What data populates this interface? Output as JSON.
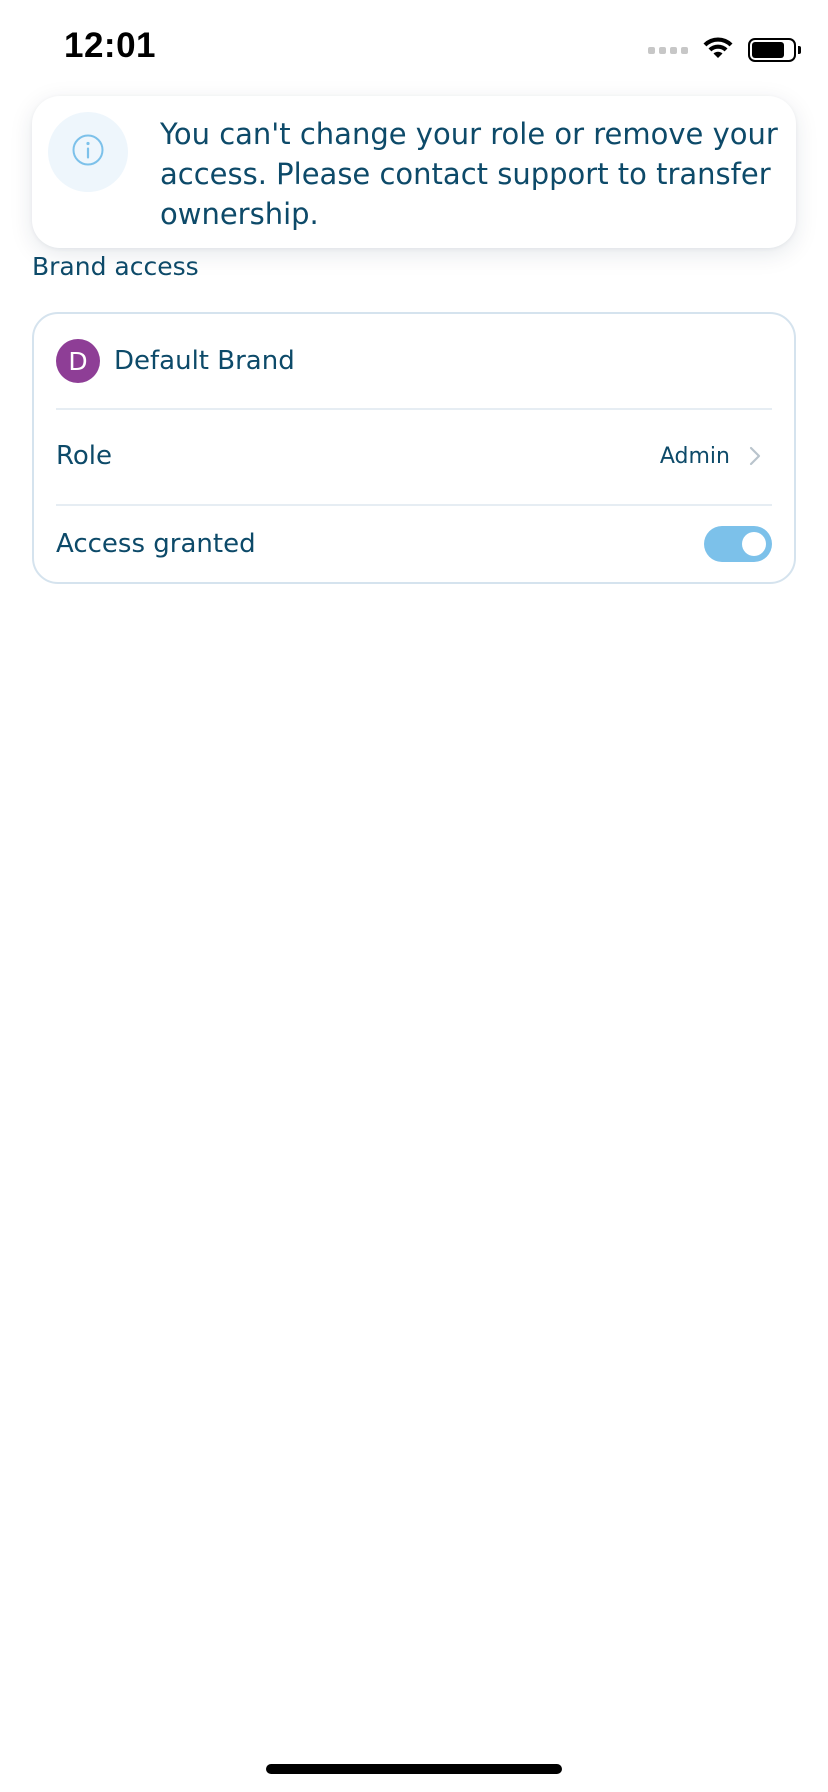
{
  "status_bar": {
    "time": "12:01",
    "icons": [
      "cellular-signal-icon",
      "wifi-icon",
      "battery-icon"
    ],
    "battery_level": 0.8
  },
  "notice": {
    "icon": "info-icon",
    "message": "You can't change your role or remove your access. Please contact support to transfer ownership."
  },
  "section": {
    "label": "Brand access"
  },
  "brand": {
    "avatar_letter": "D",
    "avatar_color": "#8e3e96",
    "name": "Default Brand"
  },
  "role": {
    "label": "Role",
    "value": "Admin",
    "icon": "chevron-right-icon"
  },
  "access": {
    "label": "Access granted",
    "enabled": true,
    "toggle_color": "#7cc1ea"
  },
  "colors": {
    "text_primary": "#0d4a69",
    "divider": "#e6edf3",
    "card_border": "#d5e3ee",
    "info_icon": "#7cc1ea"
  }
}
